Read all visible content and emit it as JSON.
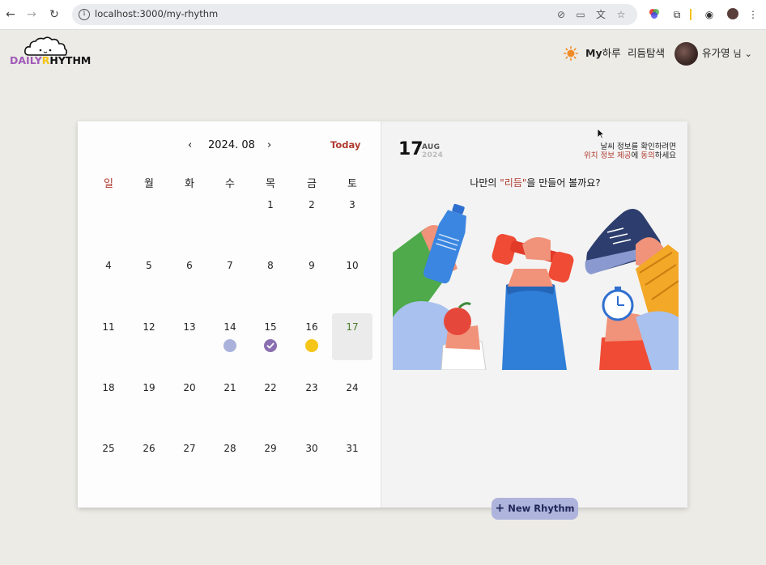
{
  "browser": {
    "url": "localhost:3000/my-rhythm"
  },
  "header": {
    "logo_text_d": "DAILY",
    "logo_text_y": "R",
    "logo_text_rest": "HYTHM",
    "nav_my_prefix": "My",
    "nav_my_suffix": "하루",
    "nav_explore": "리듬탐색",
    "user_name": "유가영",
    "user_suffix": "님"
  },
  "calendar": {
    "prev_label": "‹",
    "next_label": "›",
    "month_label": "2024. 08",
    "today_label": "Today",
    "weekdays": [
      "일",
      "월",
      "화",
      "수",
      "목",
      "금",
      "토"
    ],
    "weekday_colors": [
      "#b03a2e",
      "#222222",
      "#222222",
      "#222222",
      "#222222",
      "#222222",
      "#222222"
    ],
    "weeks": [
      [
        "",
        "",
        "",
        "",
        "1",
        "2",
        "3"
      ],
      [
        "4",
        "5",
        "6",
        "7",
        "8",
        "9",
        "10"
      ],
      [
        "11",
        "12",
        "13",
        "14",
        "15",
        "16",
        "17"
      ],
      [
        "18",
        "19",
        "20",
        "21",
        "22",
        "23",
        "24"
      ],
      [
        "25",
        "26",
        "27",
        "28",
        "29",
        "30",
        "31"
      ]
    ],
    "selected_day": "17",
    "selected_color": "#4a7c2c",
    "markers": [
      {
        "day": "14",
        "color": "#aab2dc",
        "checked": false
      },
      {
        "day": "15",
        "color": "#8a6fb0",
        "checked": true
      },
      {
        "day": "16",
        "color": "#f5c518",
        "checked": false
      }
    ]
  },
  "detail": {
    "day": "17",
    "month": "AUG",
    "year": "2024",
    "weather_line1": "날씨 정보를 확인하려면",
    "weather_red1": "위치 정보 제공",
    "weather_mid": "에 ",
    "weather_red2": "동의",
    "weather_end": "하세요",
    "headline_pre": "나만의 ",
    "headline_red": "\"리듬\"",
    "headline_post": "을 만들어 볼까요?"
  },
  "new_rhythm_label": "New Rhythm",
  "colors": {
    "accent_red": "#b03a2e",
    "button_bg": "#aeb4dc",
    "page_bg": "#ecebe6"
  }
}
